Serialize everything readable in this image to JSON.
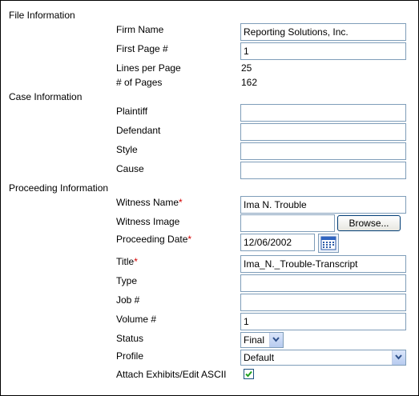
{
  "file_information": {
    "heading": "File Information",
    "firm_name": {
      "label": "Firm Name",
      "value": "Reporting Solutions, Inc."
    },
    "first_page": {
      "label": "First Page #",
      "value": "1"
    },
    "lines_per_page": {
      "label": "Lines per Page",
      "value": "25"
    },
    "num_pages": {
      "label": "# of Pages",
      "value": "162"
    }
  },
  "case_information": {
    "heading": "Case Information",
    "plaintiff": {
      "label": "Plaintiff",
      "value": ""
    },
    "defendant": {
      "label": "Defendant",
      "value": ""
    },
    "style": {
      "label": "Style",
      "value": ""
    },
    "cause": {
      "label": "Cause",
      "value": ""
    }
  },
  "proceeding_information": {
    "heading": "Proceeding Information",
    "witness_name": {
      "label": "Witness Name",
      "required_mark": "*",
      "value": "Ima N. Trouble"
    },
    "witness_image": {
      "label": "Witness Image",
      "value": "",
      "browse_label": "Browse..."
    },
    "proceeding_date": {
      "label": "Proceeding Date",
      "required_mark": "*",
      "value": "12/06/2002"
    },
    "title": {
      "label": "Title",
      "required_mark": "*",
      "value": "Ima_N._Trouble-Transcript"
    },
    "type": {
      "label": "Type",
      "value": ""
    },
    "job": {
      "label": "Job #",
      "value": ""
    },
    "volume": {
      "label": "Volume #",
      "value": "1"
    },
    "status": {
      "label": "Status",
      "value": "Final"
    },
    "profile": {
      "label": "Profile",
      "value": "Default"
    },
    "attach_exhibits": {
      "label": "Attach Exhibits/Edit ASCII",
      "checked": true
    }
  },
  "colors": {
    "required": "#d40000",
    "input_border": "#7f9db9",
    "checkmark": "#21a121"
  },
  "icons": [
    "calendar-icon",
    "dropdown-arrow-icon",
    "checkmark-icon"
  ]
}
